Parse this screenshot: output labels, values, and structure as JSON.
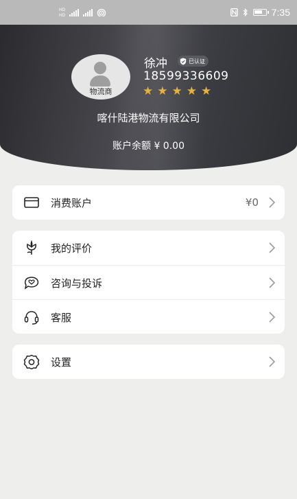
{
  "status_bar": {
    "hd_badges": [
      "HD",
      "HD"
    ],
    "network_tags": [
      "4G",
      "4G"
    ],
    "time": "7:35"
  },
  "profile": {
    "avatar_label": "物流商",
    "name": "徐冲",
    "verified_label": "已认证",
    "phone": "18599336609",
    "rating": 5,
    "stars": [
      "★",
      "★",
      "★",
      "★",
      "★"
    ],
    "company": "喀什陆港物流有限公司",
    "balance_label": "账户余额",
    "balance_value": "¥ 0.00"
  },
  "menu": {
    "account": {
      "label": "消费账户",
      "value": "¥0",
      "icon": "wallet-icon"
    },
    "reviews": {
      "label": "我的评价",
      "icon": "flower-icon"
    },
    "complaint": {
      "label": "咨询与投诉",
      "icon": "chat-heart-icon"
    },
    "service": {
      "label": "客服",
      "icon": "headset-icon"
    },
    "settings": {
      "label": "设置",
      "icon": "gear-icon"
    }
  },
  "colors": {
    "header_dark": "#2b2b2f",
    "star": "#e7b23b",
    "page_bg": "#eeefec"
  }
}
